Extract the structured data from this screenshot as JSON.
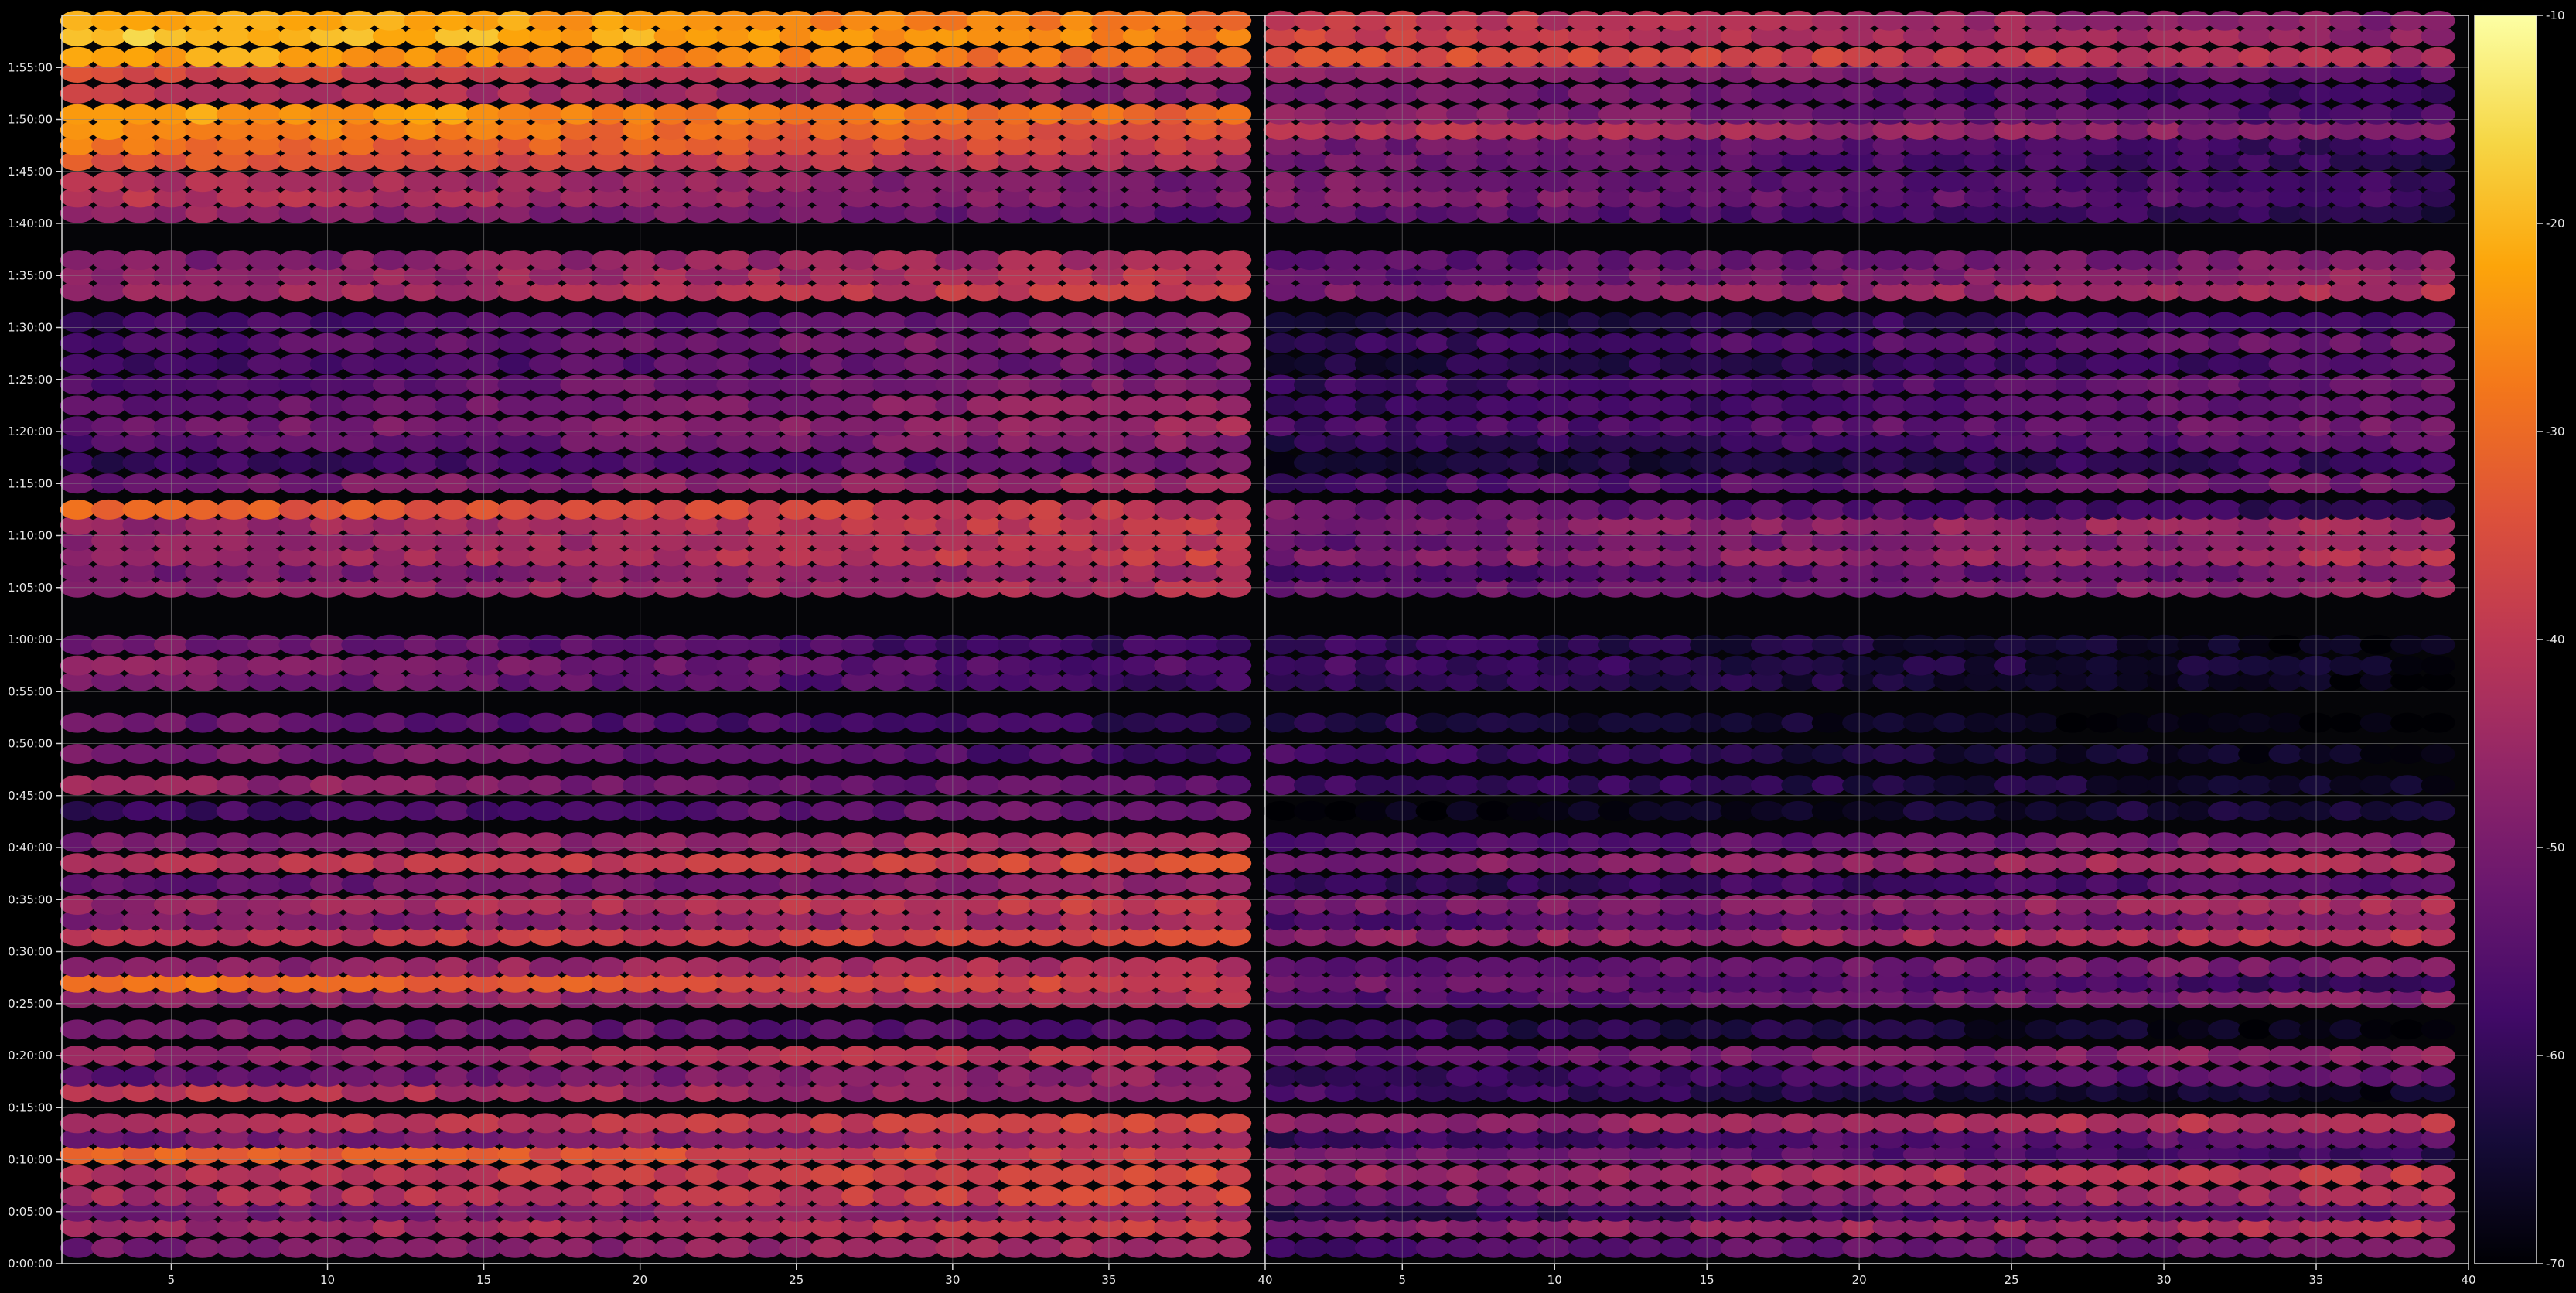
{
  "chart_data": {
    "type": "heatmap",
    "title": "",
    "xlabel": "",
    "ylabel": "",
    "background": "#000000",
    "grid": true,
    "grid_color": "#8a8a8a",
    "text_color": "#e8e8e8",
    "colormap": "inferno",
    "panels": [
      {
        "name": "left",
        "xlim": [
          1.5,
          40
        ],
        "x_ticks": [
          5,
          10,
          15,
          20,
          25,
          30,
          35,
          40
        ],
        "x_tick_labels": [
          "5",
          "10",
          "15",
          "20",
          "25",
          "30",
          "35",
          "40"
        ],
        "columns": [
          2,
          39
        ]
      },
      {
        "name": "right",
        "xlim": [
          0.5,
          40
        ],
        "x_ticks": [
          5,
          10,
          15,
          20,
          25,
          30,
          35,
          40
        ],
        "x_tick_labels": [
          "5",
          "10",
          "15",
          "20",
          "25",
          "30",
          "35",
          "40"
        ],
        "columns": [
          1,
          39
        ]
      }
    ],
    "y_axis": {
      "unit": "minutes",
      "ylim": [
        0,
        120
      ],
      "ticks": [
        0,
        5,
        10,
        15,
        20,
        25,
        30,
        35,
        40,
        45,
        50,
        55,
        60,
        65,
        70,
        75,
        80,
        85,
        90,
        95,
        100,
        105,
        110,
        115
      ],
      "tick_labels": [
        "0:00:00",
        "0:05:00",
        "0:10:00",
        "0:15:00",
        "0:20:00",
        "0:25:00",
        "0:30:00",
        "0:35:00",
        "0:40:00",
        "0:45:00",
        "0:50:00",
        "0:55:00",
        "1:00:00",
        "1:05:00",
        "1:10:00",
        "1:15:00",
        "1:20:00",
        "1:25:00",
        "1:30:00",
        "1:35:00",
        "1:40:00",
        "1:45:00",
        "1:50:00",
        "1:55:00"
      ]
    },
    "colorbar": {
      "vmin": -70,
      "vmax": -10,
      "ticks": [
        -70,
        -60,
        -50,
        -40,
        -30,
        -20,
        -10
      ],
      "tick_labels": [
        "-70",
        "-60",
        "-50",
        "-40",
        "-30",
        "-20",
        "-10"
      ]
    },
    "bands": [
      {
        "t": 1.5,
        "left": -47,
        "right": -53,
        "rising": true
      },
      {
        "t": 3.5,
        "left": -42,
        "right": -45,
        "rising": true
      },
      {
        "t": 5,
        "left": -48,
        "right": -58,
        "rising": true
      },
      {
        "t": 6.5,
        "left": -40,
        "right": -47,
        "rising": true
      },
      {
        "t": 8.5,
        "left": -39,
        "right": -43,
        "rising": true
      },
      {
        "t": 10.5,
        "left": -35,
        "right": -55,
        "rising": false
      },
      {
        "t": 12,
        "left": -48,
        "right": -56,
        "rising": true
      },
      {
        "t": 13.5,
        "left": -40,
        "right": -44,
        "rising": true
      },
      {
        "t": 16.5,
        "left": -44,
        "right": -62,
        "rising": false
      },
      {
        "t": 18,
        "left": -50,
        "right": -56,
        "rising": true
      },
      {
        "t": 20,
        "left": -43,
        "right": -50,
        "rising": true
      },
      {
        "t": 22.5,
        "left": -53,
        "right": -64,
        "rising": false
      },
      {
        "t": 25.5,
        "left": -45,
        "right": -52,
        "rising": true
      },
      {
        "t": 27,
        "left": -33,
        "right": -55,
        "rising": false
      },
      {
        "t": 28.5,
        "left": -45,
        "right": -52,
        "rising": true
      },
      {
        "t": 31.5,
        "left": -38,
        "right": -44,
        "rising": true
      },
      {
        "t": 33,
        "left": -47,
        "right": -53,
        "rising": true
      },
      {
        "t": 34.5,
        "left": -42,
        "right": -47,
        "rising": true
      },
      {
        "t": 36.5,
        "left": -50,
        "right": -58,
        "rising": true
      },
      {
        "t": 38.5,
        "left": -39,
        "right": -46,
        "rising": true
      },
      {
        "t": 40.5,
        "left": -46,
        "right": -53,
        "rising": true
      },
      {
        "t": 43.5,
        "left": -55,
        "right": -66,
        "rising": true
      },
      {
        "t": 46,
        "left": -50,
        "right": -62,
        "rising": false
      },
      {
        "t": 49,
        "left": -53,
        "right": -63,
        "rising": false
      },
      {
        "t": 52,
        "left": -56,
        "right": -66,
        "rising": false
      },
      {
        "t": 56,
        "left": -54,
        "right": -64,
        "rising": false
      },
      {
        "t": 57.5,
        "left": -52,
        "right": -62,
        "rising": false
      },
      {
        "t": 59.5,
        "left": -55,
        "right": -64,
        "rising": false
      },
      {
        "t": 65,
        "left": -45,
        "right": -50,
        "rising": true
      },
      {
        "t": 66.5,
        "left": -48,
        "right": -54,
        "rising": true
      },
      {
        "t": 68,
        "left": -42,
        "right": -46,
        "rising": true
      },
      {
        "t": 69.5,
        "left": -44,
        "right": -50,
        "rising": true
      },
      {
        "t": 71,
        "left": -42,
        "right": -47,
        "rising": true
      },
      {
        "t": 72.5,
        "left": -36,
        "right": -56,
        "rising": false
      },
      {
        "t": 75,
        "left": -48,
        "right": -54,
        "rising": true
      },
      {
        "t": 77,
        "left": -56,
        "right": -62,
        "rising": true
      },
      {
        "t": 79,
        "left": -52,
        "right": -58,
        "rising": true
      },
      {
        "t": 80.5,
        "left": -48,
        "right": -54,
        "rising": true
      },
      {
        "t": 82.5,
        "left": -50,
        "right": -56,
        "rising": true
      },
      {
        "t": 84.5,
        "left": -52,
        "right": -56,
        "rising": true
      },
      {
        "t": 86.5,
        "left": -55,
        "right": -60,
        "rising": true
      },
      {
        "t": 88.5,
        "left": -52,
        "right": -56,
        "rising": true
      },
      {
        "t": 90.5,
        "left": -55,
        "right": -60,
        "rising": true
      },
      {
        "t": 93.5,
        "left": -42,
        "right": -46,
        "rising": true
      },
      {
        "t": 95,
        "left": -44,
        "right": -50,
        "rising": true
      },
      {
        "t": 96.5,
        "left": -46,
        "right": -52,
        "rising": true
      },
      {
        "t": 101,
        "left": -50,
        "right": -57,
        "rising": false
      },
      {
        "t": 102.5,
        "left": -45,
        "right": -53,
        "rising": false
      },
      {
        "t": 104,
        "left": -46,
        "right": -54,
        "rising": false
      },
      {
        "t": 106,
        "left": -38,
        "right": -56,
        "rising": false
      },
      {
        "t": 107.5,
        "left": -33,
        "right": -55,
        "rising": false
      },
      {
        "t": 109,
        "left": -30,
        "right": -45,
        "rising": false
      },
      {
        "t": 110.5,
        "left": -26,
        "right": -52,
        "rising": false
      },
      {
        "t": 112.5,
        "left": -44,
        "right": -54,
        "rising": false
      },
      {
        "t": 114.5,
        "left": -40,
        "right": -50,
        "rising": false
      },
      {
        "t": 116,
        "left": -26,
        "right": -38,
        "rising": false
      },
      {
        "t": 118,
        "left": -22,
        "right": -42,
        "rising": false
      },
      {
        "t": 119.5,
        "left": -24,
        "right": -44,
        "rising": false
      }
    ]
  }
}
